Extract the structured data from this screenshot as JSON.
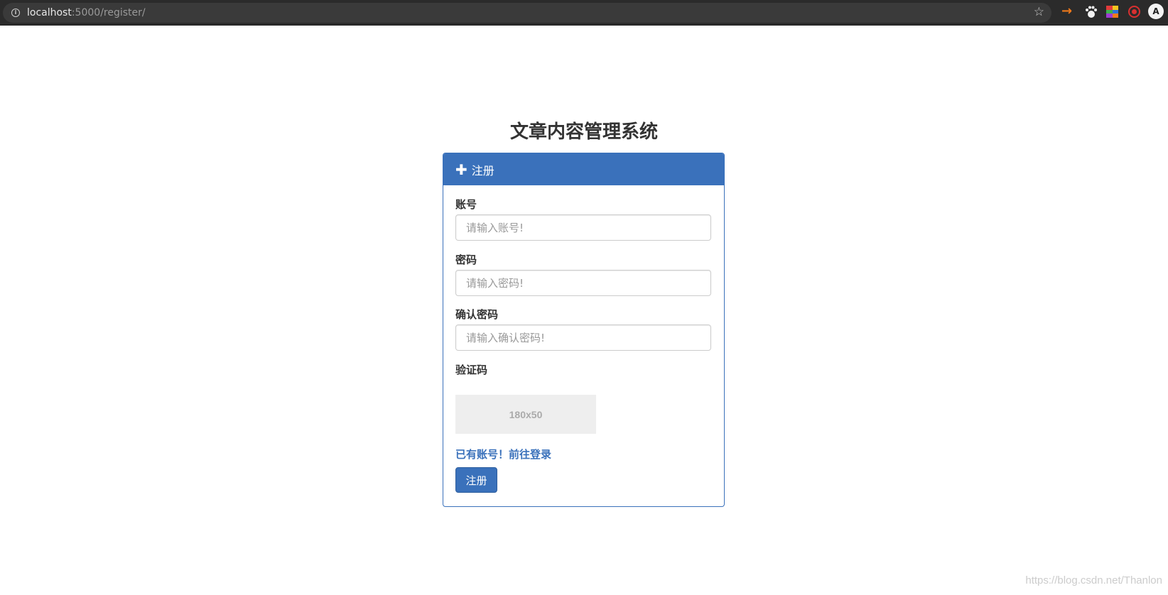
{
  "browser": {
    "url_host": "localhost",
    "url_path": ":5000/register/"
  },
  "page": {
    "title": "文章内容管理系统"
  },
  "panel": {
    "heading_icon": "plus-icon",
    "heading": "注册",
    "account_label": "账号",
    "account_placeholder": "请输入账号!",
    "password_label": "密码",
    "password_placeholder": "请输入密码!",
    "confirm_label": "确认密码",
    "confirm_placeholder": "请输入确认密码!",
    "captcha_label": "验证码",
    "captcha_text": "180x50",
    "login_link": "已有账号！前往登录",
    "submit_label": "注册"
  },
  "watermark": "https://blog.csdn.net/Thanlon",
  "colors": {
    "accent": "#3a71bb",
    "browser_bar": "#2b2b2b"
  }
}
